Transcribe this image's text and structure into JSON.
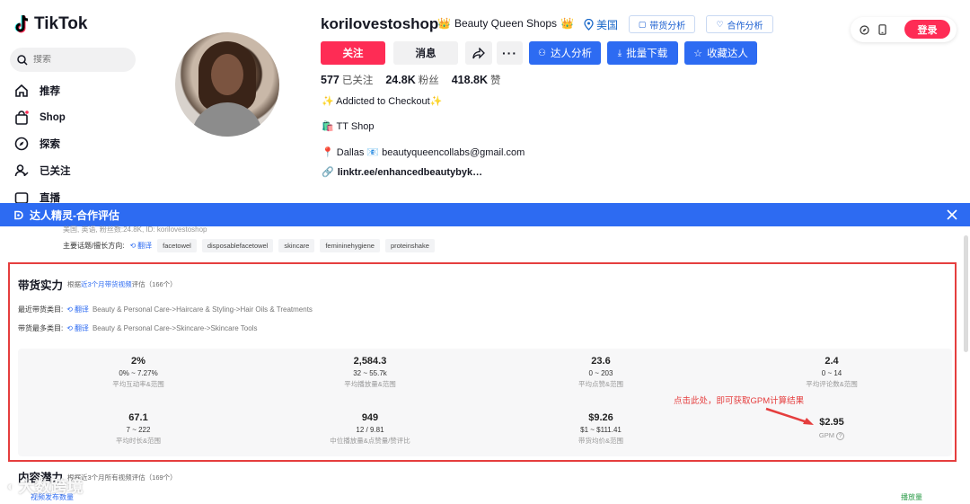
{
  "sidebar": {
    "brand": "TikTok",
    "search_placeholder": "搜索",
    "items": [
      {
        "label": "推荐",
        "icon": "home-icon"
      },
      {
        "label": "Shop",
        "icon": "shop-bag-icon"
      },
      {
        "label": "探索",
        "icon": "compass-icon"
      },
      {
        "label": "已关注",
        "icon": "following-user-icon"
      },
      {
        "label": "直播",
        "icon": "live-icon"
      }
    ]
  },
  "profile": {
    "username": "korilovestoshop",
    "shop_badge": "Beauty Queen Shops",
    "region": "美国",
    "tool_buttons": [
      "带货分析",
      "合作分析"
    ],
    "actions": {
      "follow": "关注",
      "message": "消息",
      "analyze": "达人分析",
      "batch_download": "批量下载",
      "collect": "收藏达人"
    },
    "stats": [
      {
        "value": "577",
        "label": "已关注"
      },
      {
        "value": "24.8K",
        "label": "粉丝"
      },
      {
        "value": "418.8K",
        "label": "赞"
      }
    ],
    "bio": [
      "✨ Addicted to Checkout✨",
      "🛍️ TT Shop",
      "📍 Dallas 📧 beautyqueencollabs@gmail.com"
    ],
    "link": "linktr.ee/enhancedbeautybyk…"
  },
  "top_right": {
    "login": "登录"
  },
  "panel": {
    "title": "达人精灵-合作评估",
    "meta": "美国, 英语, 粉丝数:24.8K, ID: korilovestoshop",
    "topic_label": "主要话题/擅长方向:",
    "translate": "翻译",
    "topics": [
      "facetowel",
      "disposablefacetowel",
      "skincare",
      "femininehygiene",
      "proteinshake"
    ],
    "sales": {
      "title": "带货实力",
      "subtitle_prefix": "根据",
      "subtitle_link": "近3个月带货视频",
      "subtitle_suffix": "评估（166个）",
      "recent_label": "最近带货类目:",
      "recent_value": "Beauty & Personal Care->Haircare & Styling->Hair Oils & Treatments",
      "most_label": "带货最多类目:",
      "most_value": "Beauty & Personal Care->Skincare->Skincare Tools"
    },
    "metrics": [
      {
        "value": "2%",
        "range": "0% ~ 7.27%",
        "label": "平均互动率&范围"
      },
      {
        "value": "2,584.3",
        "range": "32 ~ 55.7k",
        "label": "平均播放量&范围"
      },
      {
        "value": "23.6",
        "range": "0 ~ 203",
        "label": "平均点赞&范围"
      },
      {
        "value": "2.4",
        "range": "0 ~ 14",
        "label": "平均评论数&范围"
      },
      {
        "value": "67.1",
        "range": "7 ~ 222",
        "label": "平均时长&范围"
      },
      {
        "value": "949",
        "range": "12 / 9.81",
        "label": "中位播放量&点赞量/赞评比"
      },
      {
        "value": "$9.26",
        "range": "$1 ~ $111.41",
        "label": "带货均价&范围"
      },
      {
        "value": "$2.95",
        "range": "",
        "label": "GPM"
      }
    ],
    "note": "点击此处，即可获取GPM计算结果",
    "content": {
      "title": "内容潜力",
      "subtitle": "根据近3个月所有视频评估（169个）",
      "left_link": "视频发布数量",
      "right_link": "播放量"
    }
  },
  "watermark": "大数跨境",
  "colors": {
    "brand_red": "#fe2c55",
    "panel_blue": "#2d6bf2",
    "highlight_red": "#e53e3e"
  }
}
